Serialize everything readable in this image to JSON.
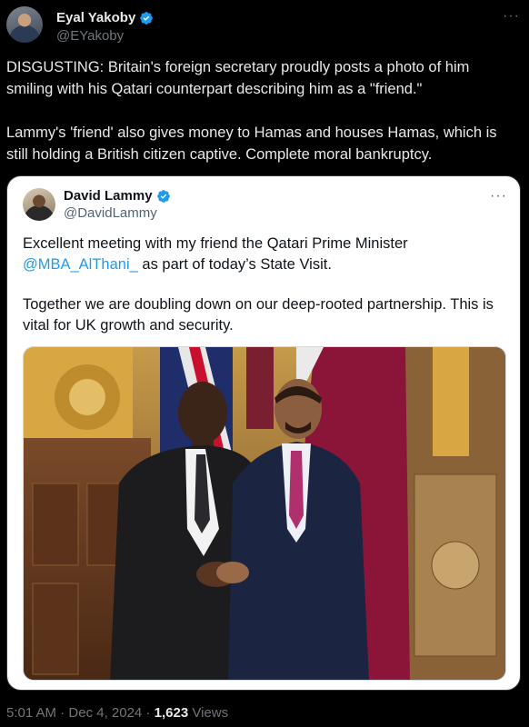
{
  "tweet": {
    "author_name": "Eyal Yakoby",
    "author_handle": "@EYakoby",
    "text": "DISGUSTING: Britain's foreign secretary proudly posts a photo of him smiling with his Qatari counterpart describing him as a \"friend.\"\n\nLammy's 'friend' also gives money to Hamas and houses Hamas, which is still holding a British citizen captive. Complete moral bankruptcy.",
    "more_icon": "more-horizontal-icon",
    "time": "5:01 AM",
    "date": "Dec 4, 2024",
    "separator": "·",
    "views_count": "1,623",
    "views_label": "Views"
  },
  "quote": {
    "author_name": "David Lammy",
    "author_handle": "@DavidLammy",
    "line1_before": "Excellent meeting with my friend the Qatari Prime Minister",
    "mention": "@MBA_AlThani_",
    "line2_after": " as part of today’s State Visit.",
    "paragraph2": "Together we are doubling down on our deep-rooted partnership. This is vital for UK growth and security."
  },
  "colors": {
    "verified": "#1d9bf0",
    "link": "#1d9bf0",
    "background": "#000000"
  }
}
